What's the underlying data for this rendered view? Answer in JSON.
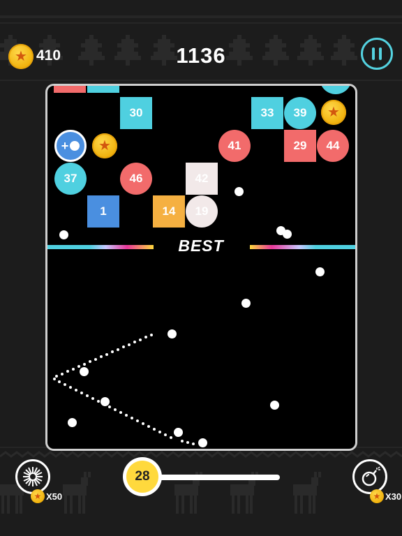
{
  "header": {
    "coins": "410",
    "score": "1136",
    "coin_icon": "star-coin",
    "pause_icon": "pause"
  },
  "board": {
    "best_label": "BEST",
    "blocks": [
      {
        "label": "",
        "shape": "square",
        "color": "#f26b6b"
      },
      {
        "label": "",
        "shape": "square",
        "color": "#4fd0e0"
      },
      {
        "label": "",
        "shape": "circle",
        "color": "#4fd0e0"
      },
      {
        "label": "30",
        "shape": "square",
        "color": "#4fd0e0"
      },
      {
        "label": "33",
        "shape": "square",
        "color": "#4fd0e0"
      },
      {
        "label": "39",
        "shape": "circle",
        "color": "#4fd0e0"
      },
      {
        "label": "41",
        "shape": "circle",
        "color": "#f26b6b"
      },
      {
        "label": "29",
        "shape": "square",
        "color": "#f26b6b"
      },
      {
        "label": "44",
        "shape": "circle",
        "color": "#f26b6b"
      },
      {
        "label": "37",
        "shape": "circle",
        "color": "#4fd0e0"
      },
      {
        "label": "46",
        "shape": "circle",
        "color": "#f26b6b"
      },
      {
        "label": "42",
        "shape": "square",
        "color": "#f2e9e9"
      },
      {
        "label": "1",
        "shape": "square",
        "color": "#4a8fe0"
      },
      {
        "label": "14",
        "shape": "square",
        "color": "#f5b041"
      },
      {
        "label": "19",
        "shape": "circle",
        "color": "#f2e9e9"
      }
    ],
    "extra_ball_label": "+",
    "extra_ball_color": "#4a8fe0",
    "coin_icon": "star-coin"
  },
  "footer": {
    "level": "28",
    "powerup_left_cost": "X50",
    "powerup_right_cost": "X30",
    "powerup_left_icon": "burst-icon",
    "powerup_right_icon": "bomb-icon"
  },
  "colors": {
    "accent_cyan": "#54d2e0",
    "red": "#f26b6b",
    "blue": "#4a8fe0",
    "orange": "#f5b041",
    "yellow": "#ffd93d",
    "pink": "#e8389a"
  }
}
